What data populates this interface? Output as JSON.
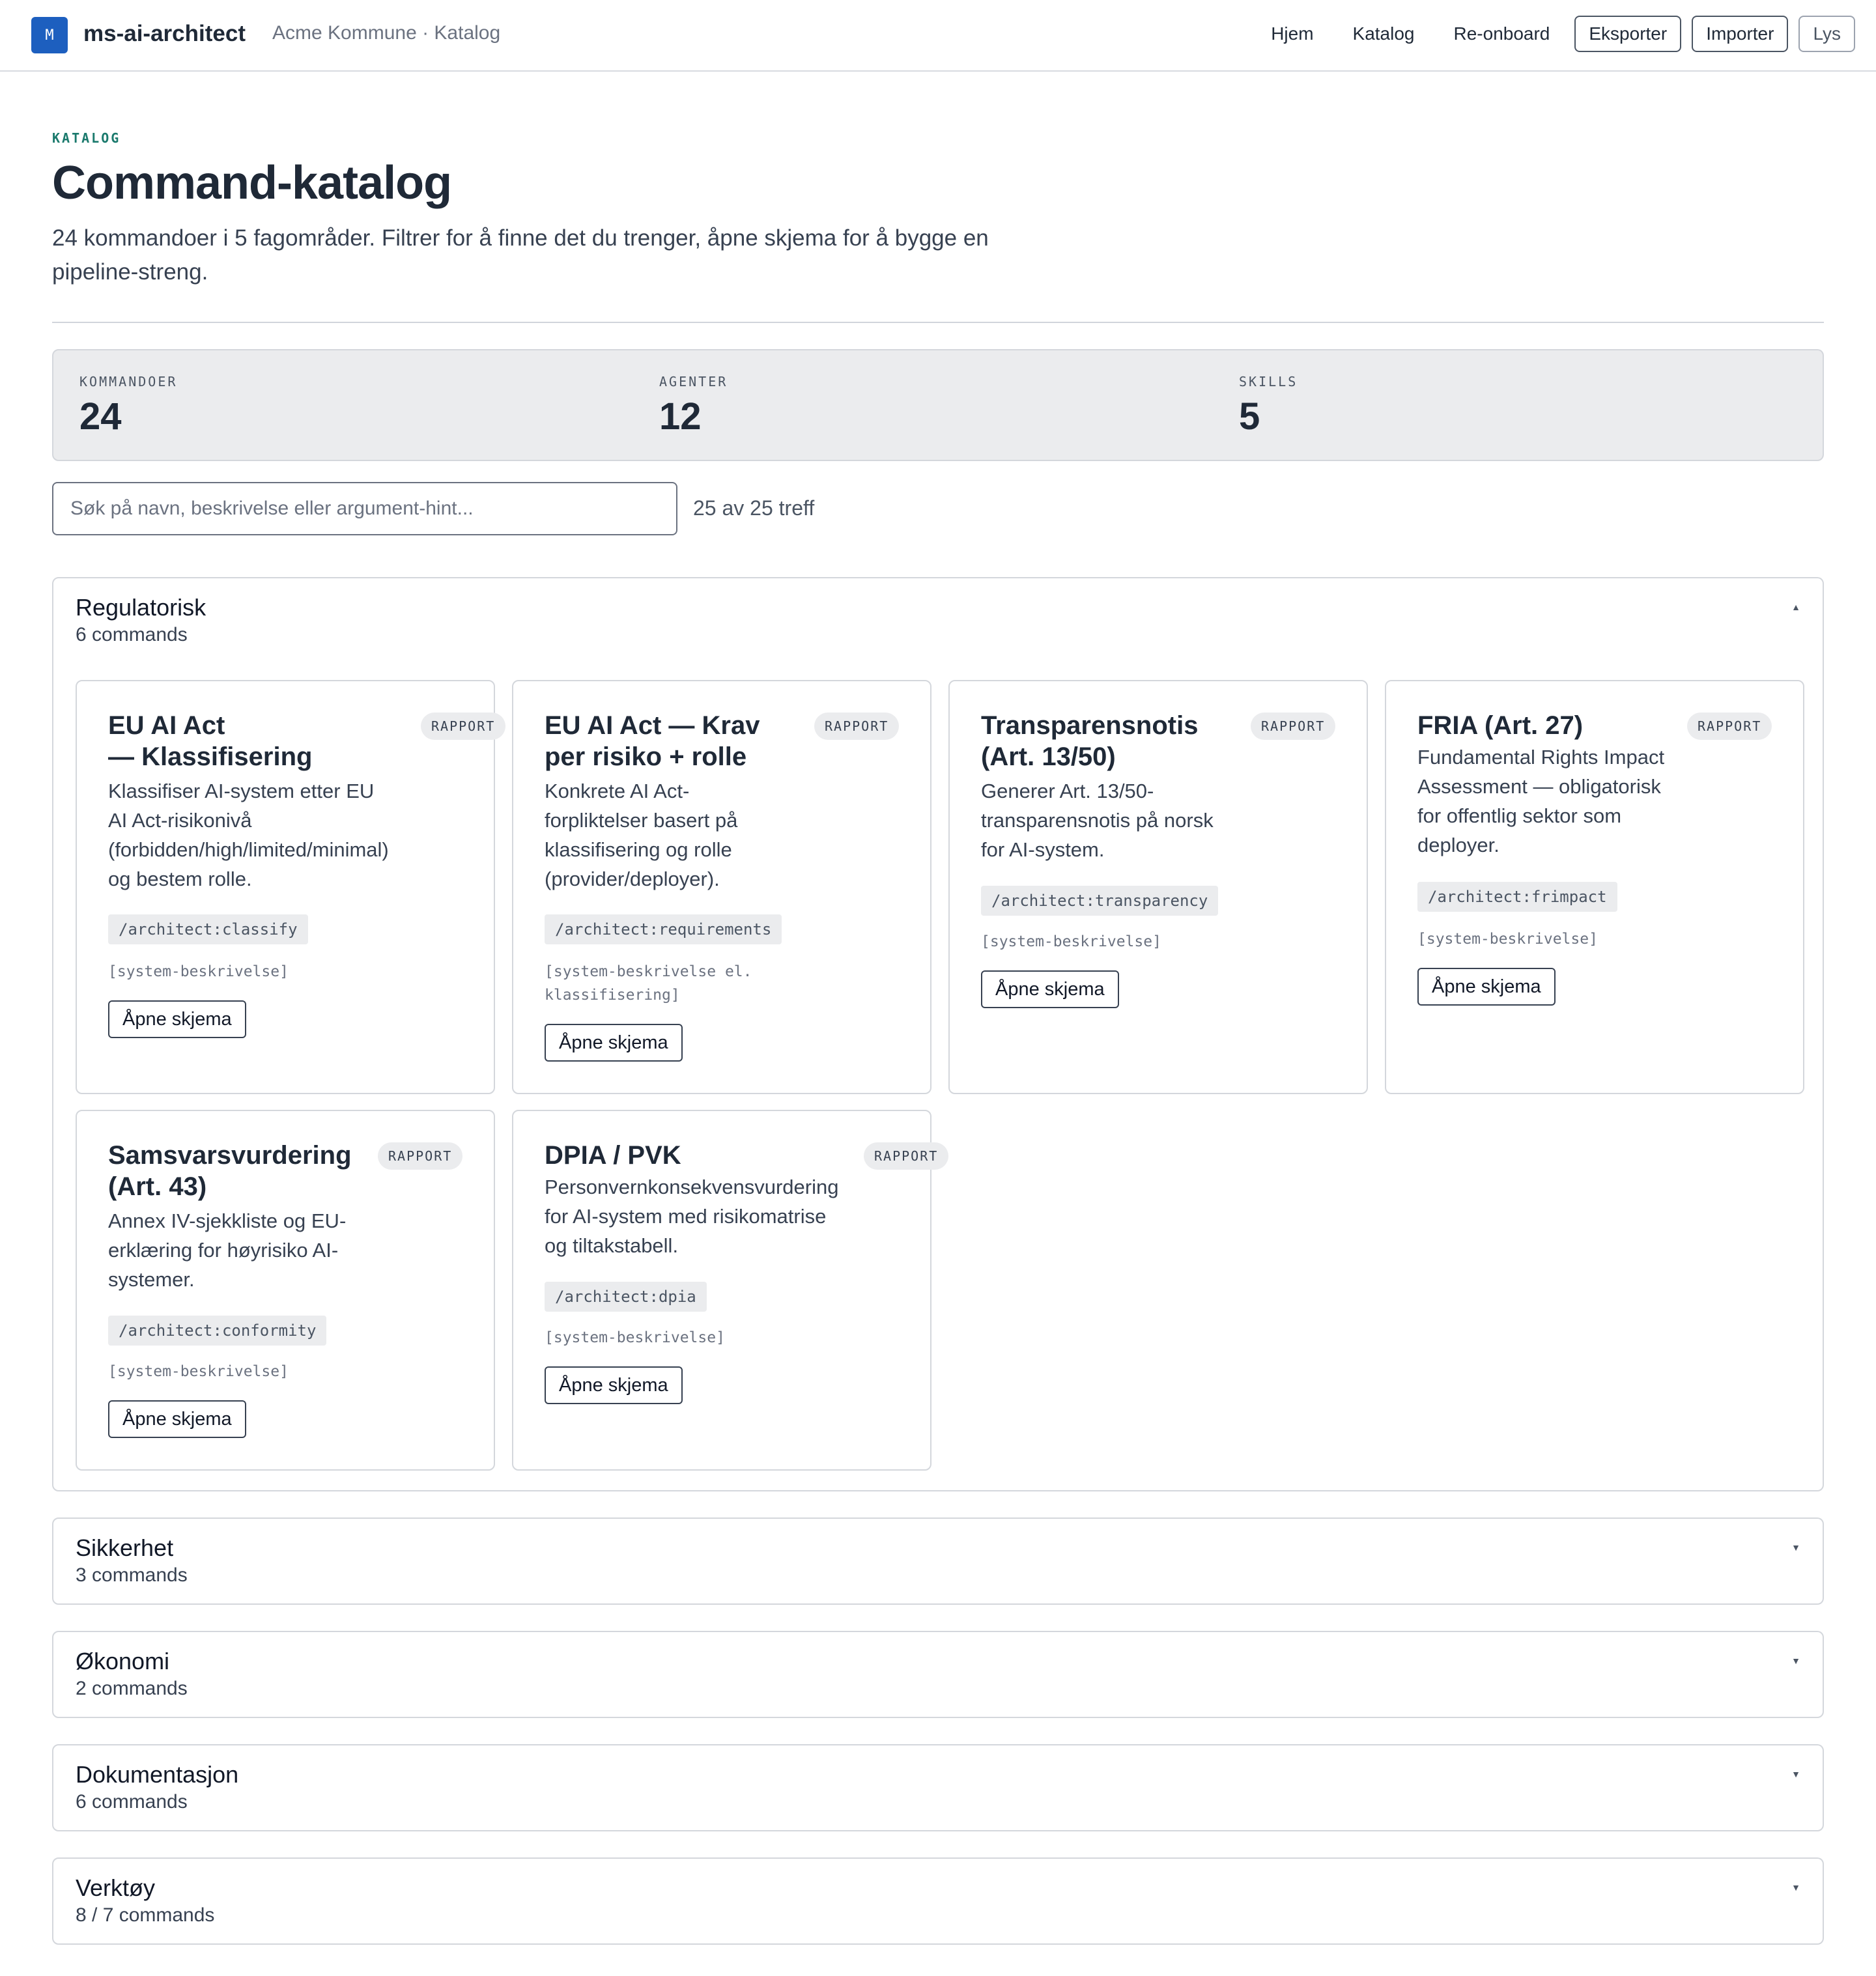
{
  "header": {
    "logo_letter": "M",
    "brand": "ms-ai-architect",
    "breadcrumb": "Acme Kommune · Katalog",
    "nav": [
      "Hjem",
      "Katalog",
      "Re-onboard"
    ],
    "buttons": [
      "Eksporter",
      "Importer",
      "Lys"
    ]
  },
  "page": {
    "eyebrow": "KATALOG",
    "title": "Command-katalog",
    "subtitle": "24 kommandoer i 5 fagområder. Filtrer for å finne det du trenger, åpne skjema for å bygge en pipeline-streng."
  },
  "stats": [
    {
      "label": "KOMMANDOER",
      "value": "24"
    },
    {
      "label": "AGENTER",
      "value": "12"
    },
    {
      "label": "SKILLS",
      "value": "5"
    }
  ],
  "search": {
    "placeholder": "Søk på navn, beskrivelse eller argument-hint...",
    "value": "",
    "hits": "25 av 25 treff"
  },
  "categories": [
    {
      "name": "Regulatorisk",
      "count": "6 commands",
      "expanded": true
    },
    {
      "name": "Sikkerhet",
      "count": "3 commands",
      "expanded": false
    },
    {
      "name": "Økonomi",
      "count": "2 commands",
      "expanded": false
    },
    {
      "name": "Dokumentasjon",
      "count": "6 commands",
      "expanded": false
    },
    {
      "name": "Verktøy",
      "count": "8 / 7 commands",
      "expanded": false
    }
  ],
  "icons": {
    "expanded": "chevron-up-icon",
    "collapsed": "chevron-down-icon"
  },
  "cards": [
    {
      "title_lines": [
        "EU AI Act",
        "— Klassifisering"
      ],
      "badge": "RAPPORT",
      "desc_lines": [
        "Klassifiser AI-system etter EU",
        "AI Act-risikonivå",
        "(forbidden/high/limited/minimal)",
        "og bestem rolle."
      ],
      "command": "/architect:classify",
      "args_lines": [
        "[system-beskrivelse]"
      ],
      "button": "Åpne skjema"
    },
    {
      "title_lines": [
        "EU AI Act — Krav",
        "per risiko + rolle"
      ],
      "badge": "RAPPORT",
      "desc_lines": [
        "Konkrete AI Act-",
        "forpliktelser basert på",
        "klassifisering og rolle",
        "(provider/deployer)."
      ],
      "command": "/architect:requirements",
      "args_lines": [
        "[system-beskrivelse el.",
        "klassifisering]"
      ],
      "button": "Åpne skjema"
    },
    {
      "title_lines": [
        "Transparensnotis",
        "(Art. 13/50)"
      ],
      "badge": "RAPPORT",
      "desc_lines": [
        "Generer Art. 13/50-",
        "transparensnotis på norsk",
        "for AI-system."
      ],
      "command": "/architect:transparency",
      "args_lines": [
        "[system-beskrivelse]"
      ],
      "button": "Åpne skjema"
    },
    {
      "title_lines": [
        "FRIA (Art. 27)"
      ],
      "badge": "RAPPORT",
      "desc_lines": [
        "Fundamental Rights Impact",
        "Assessment — obligatorisk",
        "for offentlig sektor som",
        "deployer."
      ],
      "command": "/architect:frimpact",
      "args_lines": [
        "[system-beskrivelse]"
      ],
      "button": "Åpne skjema"
    },
    {
      "title_lines": [
        "Samsvarsvurdering",
        "(Art. 43)"
      ],
      "badge": "RAPPORT",
      "desc_lines": [
        "Annex IV-sjekkliste og EU-",
        "erklæring for høyrisiko AI-",
        "systemer."
      ],
      "command": "/architect:conformity",
      "args_lines": [
        "[system-beskrivelse]"
      ],
      "button": "Åpne skjema"
    },
    {
      "title_lines": [
        "DPIA / PVK"
      ],
      "badge": "RAPPORT",
      "desc_lines": [
        "Personvernkonsekvensvurdering",
        "for AI-system med risikomatrise",
        "og tiltakstabell."
      ],
      "command": "/architect:dpia",
      "args_lines": [
        "[system-beskrivelse]"
      ],
      "button": "Åpne skjema"
    }
  ]
}
